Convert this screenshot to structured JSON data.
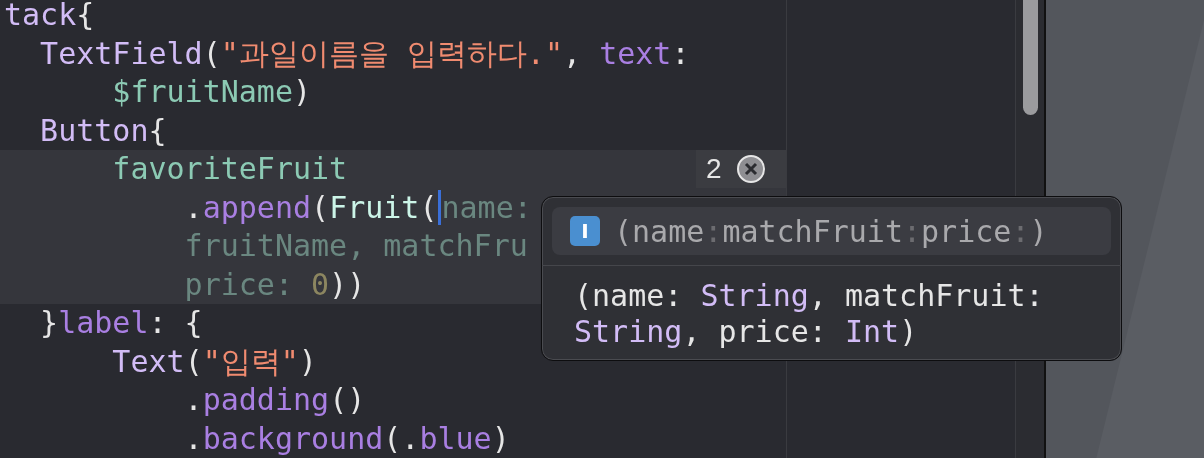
{
  "editor": {
    "lines": [
      {
        "highlighted": false,
        "tokens": [
          {
            "kind": "type",
            "text": "tack"
          },
          {
            "kind": "plain",
            "text": "{"
          }
        ]
      },
      {
        "highlighted": false,
        "tokens": [
          {
            "kind": "type",
            "text": "  TextField"
          },
          {
            "kind": "plain",
            "text": "("
          },
          {
            "kind": "string",
            "text": "\"과일이름을 입력하다.\""
          },
          {
            "kind": "plain",
            "text": ", "
          },
          {
            "kind": "keyword",
            "text": "text"
          },
          {
            "kind": "plain",
            "text": ":"
          }
        ]
      },
      {
        "highlighted": false,
        "tokens": [
          {
            "kind": "variable",
            "text": "      $fruitName"
          },
          {
            "kind": "plain",
            "text": ")"
          }
        ]
      },
      {
        "highlighted": false,
        "tokens": [
          {
            "kind": "type",
            "text": "  Button"
          },
          {
            "kind": "plain",
            "text": "{"
          }
        ]
      },
      {
        "highlighted": true,
        "tokens": [
          {
            "kind": "variable",
            "text": "      favoriteFruit"
          }
        ],
        "error_badge": {
          "count": "2"
        }
      },
      {
        "highlighted": true,
        "tokens": [
          {
            "kind": "plain",
            "text": "          ."
          },
          {
            "kind": "keyword",
            "text": "append"
          },
          {
            "kind": "plain",
            "text": "("
          },
          {
            "kind": "class",
            "text": "Fruit"
          },
          {
            "kind": "plain",
            "text": "("
          },
          {
            "kind": "placeholder",
            "text": "name:",
            "cursor": true
          }
        ]
      },
      {
        "highlighted": true,
        "tokens": [
          {
            "kind": "placeholder",
            "text": "          fruitName, matchFru"
          }
        ]
      },
      {
        "highlighted": true,
        "tokens": [
          {
            "kind": "placeholder",
            "text": "          price: "
          },
          {
            "kind": "number",
            "text": "0"
          },
          {
            "kind": "plain",
            "text": "))"
          }
        ]
      },
      {
        "highlighted": false,
        "tokens": [
          {
            "kind": "plain",
            "text": "  }"
          },
          {
            "kind": "keyword",
            "text": "label"
          },
          {
            "kind": "plain",
            "text": ": {"
          }
        ]
      },
      {
        "highlighted": false,
        "tokens": [
          {
            "kind": "type",
            "text": "      Text"
          },
          {
            "kind": "plain",
            "text": "("
          },
          {
            "kind": "string",
            "text": "\"입력\""
          },
          {
            "kind": "plain",
            "text": ")"
          }
        ]
      },
      {
        "highlighted": false,
        "tokens": [
          {
            "kind": "plain",
            "text": "          ."
          },
          {
            "kind": "keyword",
            "text": "padding"
          },
          {
            "kind": "plain",
            "text": "()"
          }
        ]
      },
      {
        "highlighted": false,
        "tokens": [
          {
            "kind": "plain",
            "text": "          ."
          },
          {
            "kind": "keyword",
            "text": "background"
          },
          {
            "kind": "plain",
            "text": "(."
          },
          {
            "kind": "keyword",
            "text": "blue"
          },
          {
            "kind": "plain",
            "text": ")"
          }
        ]
      }
    ]
  },
  "completion_popup": {
    "item": {
      "icon_letter": "I",
      "selected": true,
      "signature": [
        {
          "kind": "label",
          "text": "(name"
        },
        {
          "kind": "punct",
          "text": ":"
        },
        {
          "kind": "label",
          "text": "matchFruit"
        },
        {
          "kind": "punct",
          "text": ":"
        },
        {
          "kind": "label",
          "text": "price"
        },
        {
          "kind": "punct",
          "text": ":"
        },
        {
          "kind": "label",
          "text": ")"
        }
      ]
    },
    "detail": [
      {
        "kind": "plain",
        "text": "(name: "
      },
      {
        "kind": "type",
        "text": "String"
      },
      {
        "kind": "plain",
        "text": ", matchFruit: "
      },
      {
        "kind": "type",
        "text": "String"
      },
      {
        "kind": "plain",
        "text": ", price: "
      },
      {
        "kind": "type",
        "text": "Int"
      },
      {
        "kind": "plain",
        "text": ")"
      }
    ]
  }
}
